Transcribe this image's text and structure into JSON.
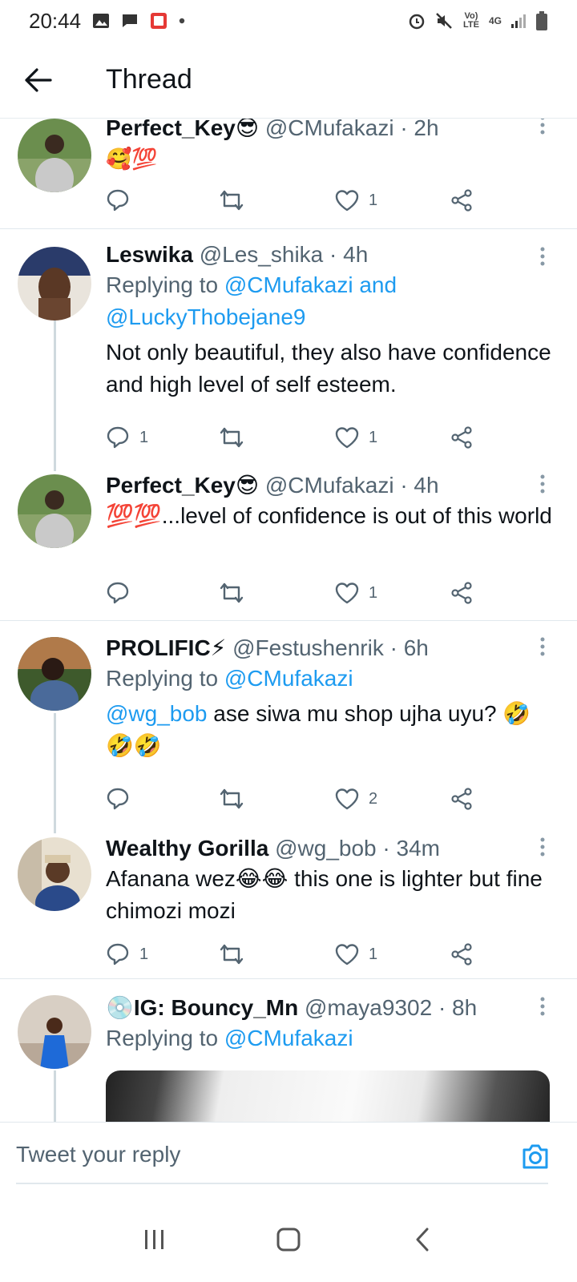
{
  "status_bar": {
    "time": "20:44",
    "network": "4G",
    "volte": "Vo) LTE"
  },
  "header": {
    "title": "Thread"
  },
  "tweets": [
    {
      "name": "Perfect_Key😎",
      "handle": "@CMufakazi",
      "time": "· 2h",
      "reply_prefix": "",
      "reply_mentions": "",
      "text": "🥰💯",
      "replies": "",
      "retweets": "",
      "likes": "1"
    },
    {
      "name": "Leswika",
      "handle": "@Les_shika",
      "time": "· 4h",
      "reply_prefix": "Replying to ",
      "reply_mentions": "@CMufakazi and @LuckyThobejane9",
      "text": "Not only beautiful, they also have confidence and high level of self esteem.",
      "replies": "1",
      "retweets": "",
      "likes": "1"
    },
    {
      "name": "Perfect_Key😎",
      "handle": "@CMufakazi",
      "time": "· 4h",
      "reply_prefix": "",
      "reply_mentions": "",
      "text": "💯💯...level of confidence  is out of this world",
      "replies": "",
      "retweets": "",
      "likes": "1"
    },
    {
      "name": "PROLIFIC⚡",
      "handle": "@Festushenrik",
      "time": "· 6h",
      "reply_prefix": "Replying to ",
      "reply_mentions": "@CMufakazi",
      "text_mention": "@wg_bob",
      "text": " ase siwa mu shop ujha uyu? 🤣🤣🤣",
      "replies": "",
      "retweets": "",
      "likes": "2"
    },
    {
      "name": "Wealthy Gorilla",
      "handle": "@wg_bob",
      "time": "· 34m",
      "reply_prefix": "",
      "reply_mentions": "",
      "text": "Afanana wez😂😂 this one is lighter but fine chimozi mozi",
      "replies": "1",
      "retweets": "",
      "likes": "1"
    },
    {
      "name": "💿IG: Bouncy_Mn",
      "handle": "@maya9302",
      "time": "· 8h",
      "reply_prefix": "Replying to ",
      "reply_mentions": "@CMufakazi",
      "text": ""
    }
  ],
  "composer": {
    "placeholder": "Tweet your reply"
  },
  "colors": {
    "link": "#1d9bf0",
    "secondary_text": "#536471",
    "divider": "#e1e8ed",
    "thread_line": "#cfd9de"
  },
  "icons": {
    "reply": "reply-icon",
    "retweet": "retweet-icon",
    "like": "heart-icon",
    "share": "share-icon",
    "more": "more-vertical-icon",
    "camera": "camera-icon"
  }
}
